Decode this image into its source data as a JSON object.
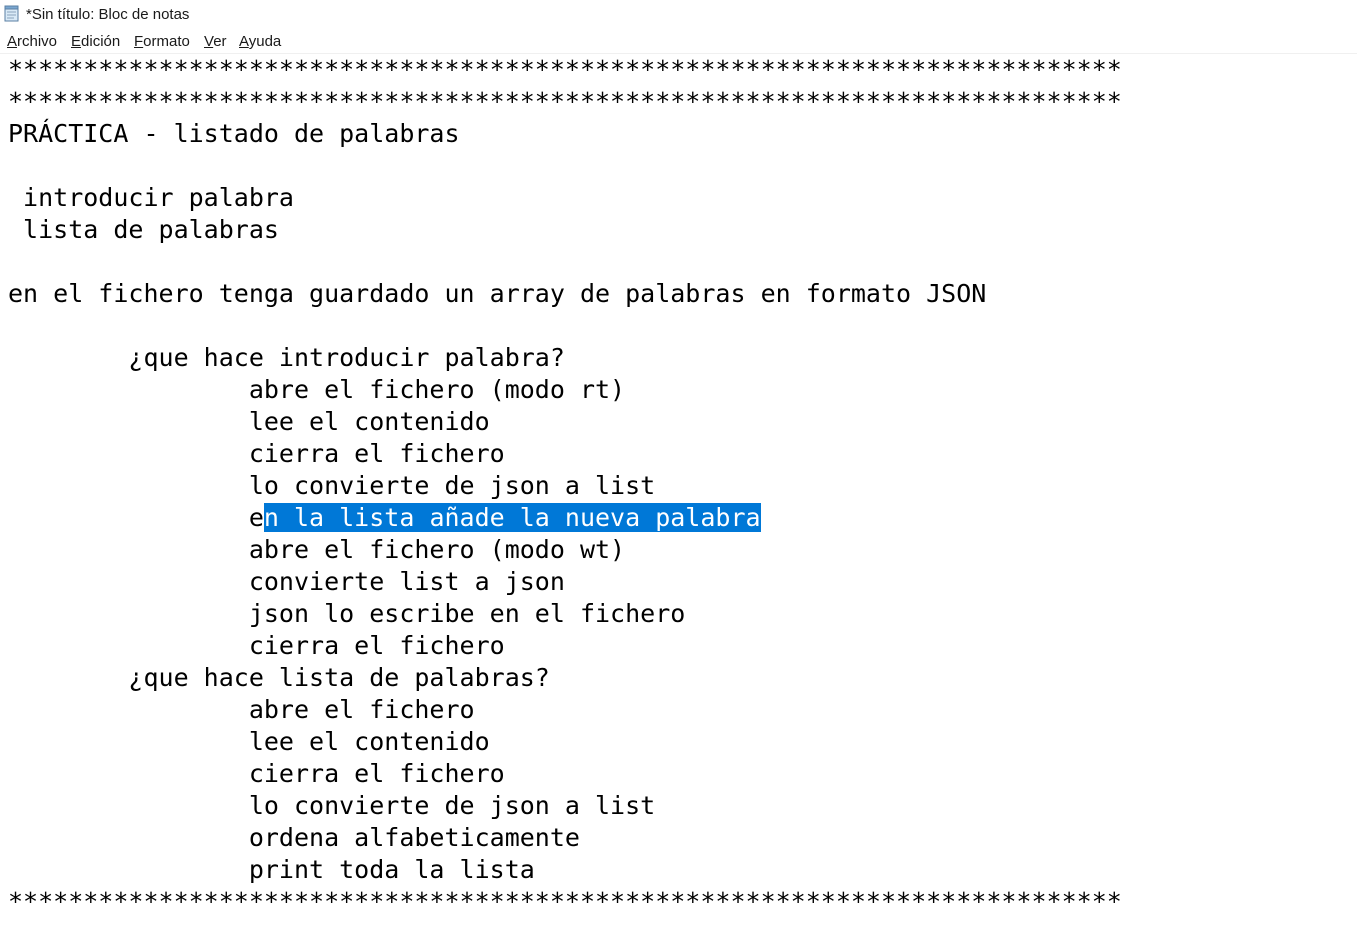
{
  "window": {
    "title": "*Sin título: Bloc de notas",
    "icon": "notepad-icon"
  },
  "menu": {
    "items": [
      {
        "mnemonic": "A",
        "rest": "rchivo"
      },
      {
        "mnemonic": "E",
        "rest": "dición"
      },
      {
        "mnemonic": "F",
        "rest": "ormato"
      },
      {
        "mnemonic": "V",
        "rest": "er"
      },
      {
        "mnemonic": "A",
        "rest": "yuda"
      }
    ]
  },
  "editor": {
    "selection_color": "#0078d7",
    "lines": [
      "**************************************************************************",
      "**************************************************************************",
      "PRÁCTICA - listado de palabras",
      "",
      " introducir palabra",
      " lista de palabras",
      "",
      "en el fichero tenga guardado un array de palabras en formato JSON",
      "",
      "        ¿que hace introducir palabra?",
      "                abre el fichero (modo rt)",
      "                lee el contenido",
      "                cierra el fichero",
      "                lo convierte de json a list",
      "                e",
      "                abre el fichero (modo wt)",
      "                convierte list a json",
      "                json lo escribe en el fichero",
      "                cierra el fichero",
      "        ¿que hace lista de palabras?",
      "                abre el fichero",
      "                lee el contenido",
      "                cierra el fichero",
      "                lo convierte de json a list",
      "                ordena alfabeticamente",
      "                print toda la lista",
      "**************************************************************************"
    ],
    "selected_text": "n la lista añade la nueva palabra"
  }
}
